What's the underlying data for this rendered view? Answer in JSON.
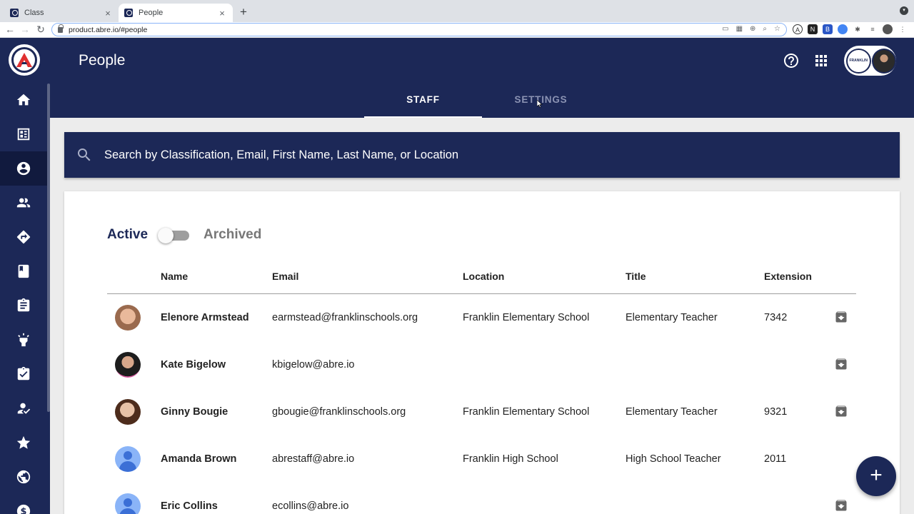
{
  "browser": {
    "tabs": [
      {
        "title": "Class",
        "active": false
      },
      {
        "title": "People",
        "active": true
      }
    ],
    "url": "product.abre.io/#people"
  },
  "header": {
    "title": "People",
    "account_badge": "FRANKLIN"
  },
  "tabs": [
    {
      "label": "STAFF",
      "active": true
    },
    {
      "label": "SETTINGS",
      "active": false
    }
  ],
  "search": {
    "placeholder": "Search by Classification, Email, First Name, Last Name, or Location"
  },
  "toggle": {
    "left_label": "Active",
    "right_label": "Archived",
    "state": "active"
  },
  "table": {
    "columns": [
      "Name",
      "Email",
      "Location",
      "Title",
      "Extension"
    ],
    "rows": [
      {
        "name": "Elenore Armstead",
        "email": "earmstead@franklinschools.org",
        "location": "Franklin Elementary School",
        "title": "Elementary Teacher",
        "extension": "7342",
        "avatar": "photo"
      },
      {
        "name": "Kate Bigelow",
        "email": "kbigelow@abre.io",
        "location": "",
        "title": "",
        "extension": "",
        "avatar": "photo"
      },
      {
        "name": "Ginny Bougie",
        "email": "gbougie@franklinschools.org",
        "location": "Franklin Elementary School",
        "title": "Elementary Teacher",
        "extension": "9321",
        "avatar": "photo"
      },
      {
        "name": "Amanda Brown",
        "email": "abrestaff@abre.io",
        "location": "Franklin High School",
        "title": "High School Teacher",
        "extension": "2011",
        "avatar": "generic"
      },
      {
        "name": "Eric Collins",
        "email": "ecollins@abre.io",
        "location": "",
        "title": "",
        "extension": "",
        "avatar": "generic"
      }
    ]
  },
  "fab": {
    "label": "+"
  },
  "colors": {
    "navy": "#1c2857",
    "sidebar_selected": "#111a3e",
    "icon_grey": "#666666"
  },
  "icons": {
    "sidebar": [
      "home-icon",
      "dashboard-icon",
      "account-circle-icon",
      "people-icon",
      "directions-icon",
      "book-icon",
      "assignment-icon",
      "lightbulb-icon",
      "assignment-turned-in-icon",
      "how-to-reg-icon",
      "stars-icon",
      "globe-icon",
      "dollar-icon"
    ],
    "header": [
      "help-icon",
      "apps-icon"
    ]
  }
}
